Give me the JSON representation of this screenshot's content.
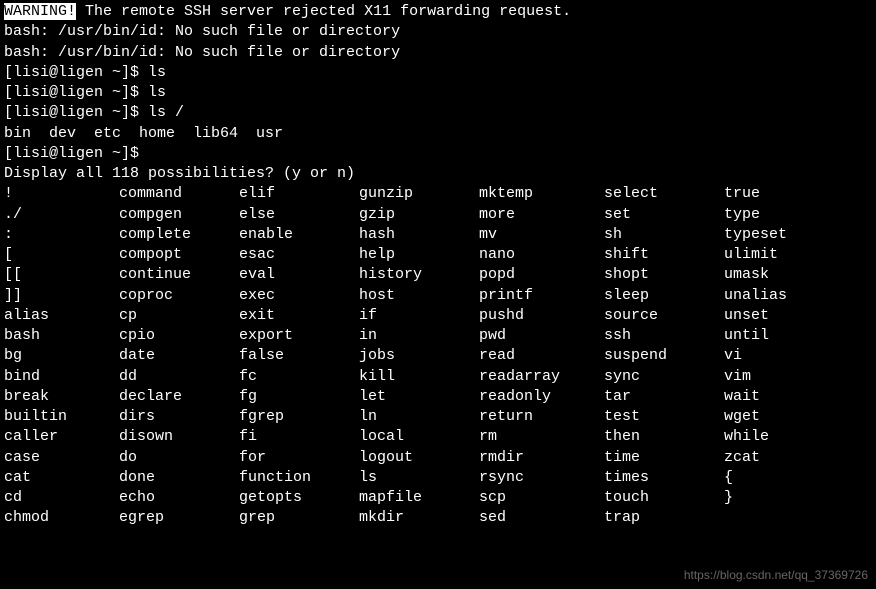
{
  "warning": {
    "label": "WARNING!",
    "message": " The remote SSH server rejected X11 forwarding request."
  },
  "errors": [
    "bash: /usr/bin/id: No such file or directory",
    "bash: /usr/bin/id: No such file or directory"
  ],
  "prompt": "[lisi@ligen ~]$ ",
  "history": [
    {
      "cmd": "ls",
      "output": []
    },
    {
      "cmd": "ls",
      "output": []
    },
    {
      "cmd": "ls /",
      "output": [
        "bin  dev  etc  home  lib64  usr"
      ]
    },
    {
      "cmd": "",
      "output": []
    }
  ],
  "tab_prompt": "Display all 118 possibilities? (y or n)",
  "columns": [
    [
      "!",
      "./",
      ":",
      "[",
      "[[",
      "]]",
      "alias",
      "bash",
      "bg",
      "bind",
      "break",
      "builtin",
      "caller",
      "case",
      "cat",
      "cd",
      "chmod"
    ],
    [
      "command",
      "compgen",
      "complete",
      "compopt",
      "continue",
      "coproc",
      "cp",
      "cpio",
      "date",
      "dd",
      "declare",
      "dirs",
      "disown",
      "do",
      "done",
      "echo",
      "egrep"
    ],
    [
      "elif",
      "else",
      "enable",
      "esac",
      "eval",
      "exec",
      "exit",
      "export",
      "false",
      "fc",
      "fg",
      "fgrep",
      "fi",
      "for",
      "function",
      "getopts",
      "grep"
    ],
    [
      "gunzip",
      "gzip",
      "hash",
      "help",
      "history",
      "host",
      "if",
      "in",
      "jobs",
      "kill",
      "let",
      "ln",
      "local",
      "logout",
      "ls",
      "mapfile",
      "mkdir"
    ],
    [
      "mktemp",
      "more",
      "mv",
      "nano",
      "popd",
      "printf",
      "pushd",
      "pwd",
      "read",
      "readarray",
      "readonly",
      "return",
      "rm",
      "rmdir",
      "rsync",
      "scp",
      "sed"
    ],
    [
      "select",
      "set",
      "sh",
      "shift",
      "shopt",
      "sleep",
      "source",
      "ssh",
      "suspend",
      "sync",
      "tar",
      "test",
      "then",
      "time",
      "times",
      "touch",
      "trap"
    ],
    [
      "true",
      "type",
      "typeset",
      "ulimit",
      "umask",
      "unalias",
      "unset",
      "until",
      "vi",
      "vim",
      "wait",
      "wget",
      "while",
      "zcat",
      "{",
      "}",
      ""
    ]
  ],
  "watermark": "https://blog.csdn.net/qq_37369726"
}
